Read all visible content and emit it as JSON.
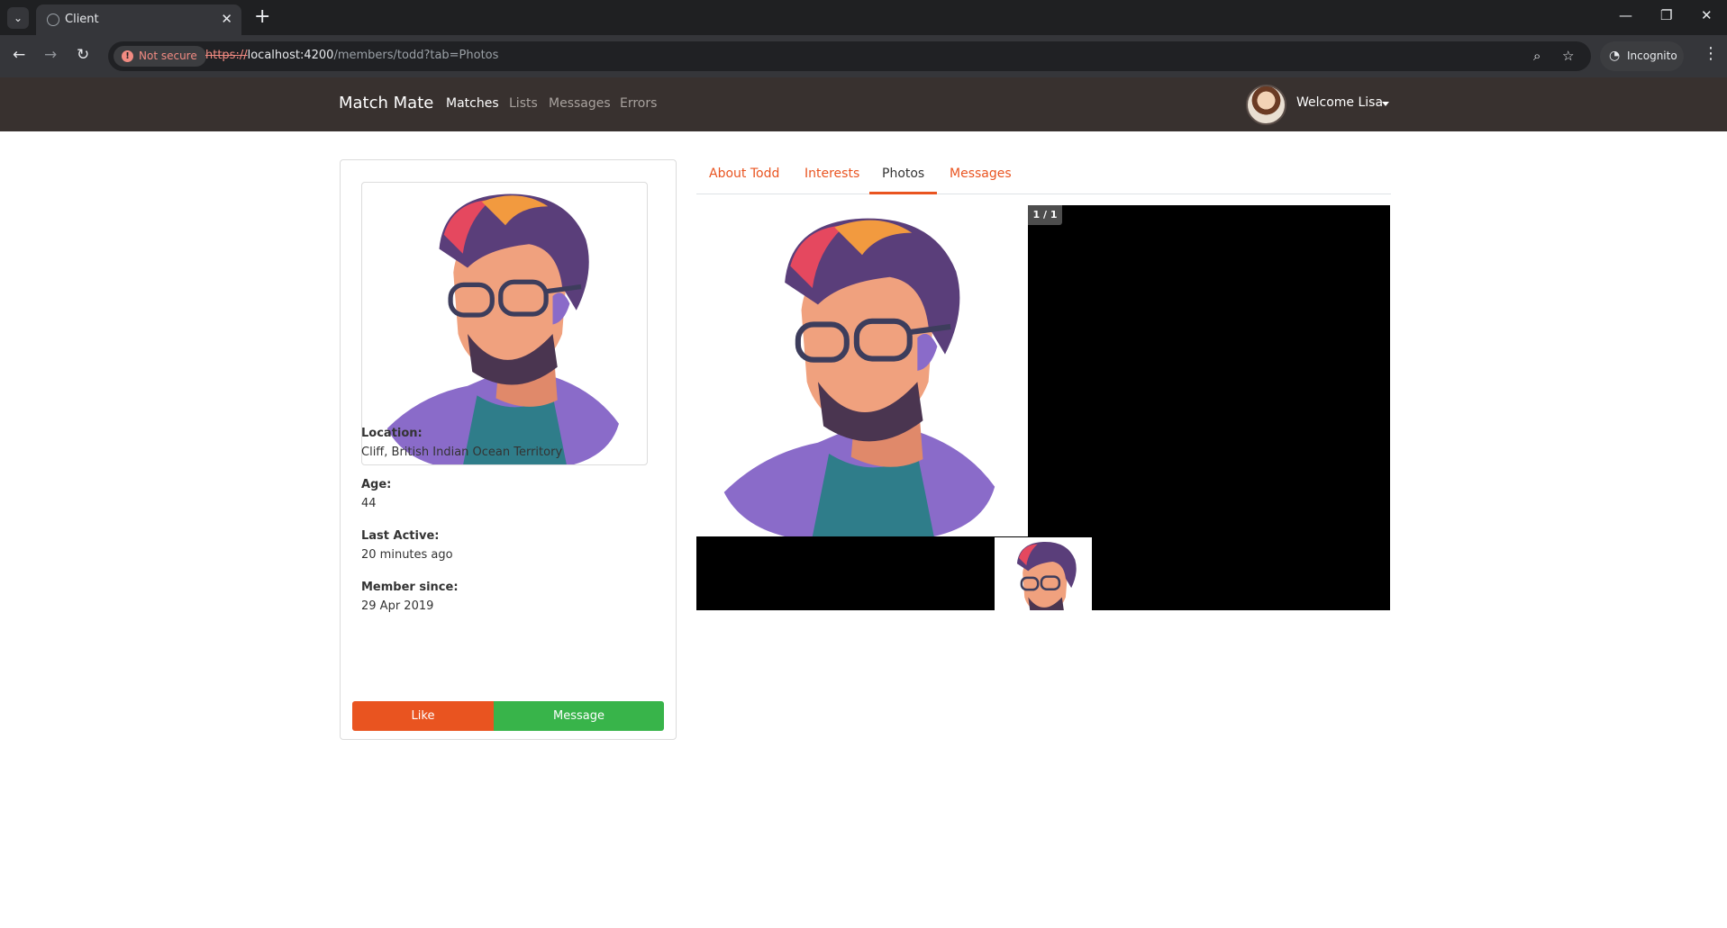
{
  "browser": {
    "tab_title": "Client",
    "security_label": "Not secure",
    "url_scheme": "https://",
    "url_host": "localhost:4200",
    "url_path": "/members/todd?tab=Photos",
    "incognito_label": "Incognito"
  },
  "navbar": {
    "brand": "Match Mate",
    "links": [
      {
        "label": "Matches",
        "active": true
      },
      {
        "label": "Lists",
        "active": false
      },
      {
        "label": "Messages",
        "active": false
      },
      {
        "label": "Errors",
        "active": false
      }
    ],
    "welcome": "Welcome Lisa"
  },
  "member": {
    "fields": [
      {
        "label": "Location:",
        "value": "Cliff, British Indian Ocean Territory"
      },
      {
        "label": "Age:",
        "value": "44"
      },
      {
        "label": "Last Active:",
        "value": "20 minutes ago"
      },
      {
        "label": "Member since:",
        "value": "29 Apr 2019"
      }
    ],
    "like_label": "Like",
    "message_label": "Message"
  },
  "tabs": [
    {
      "label": "About Todd",
      "active": false
    },
    {
      "label": "Interests",
      "active": false
    },
    {
      "label": "Photos",
      "active": true
    },
    {
      "label": "Messages",
      "active": false
    }
  ],
  "gallery": {
    "counter": "1 / 1"
  },
  "colors": {
    "primary": "#e95420",
    "success": "#38b44a",
    "navbar": "#38312f"
  }
}
